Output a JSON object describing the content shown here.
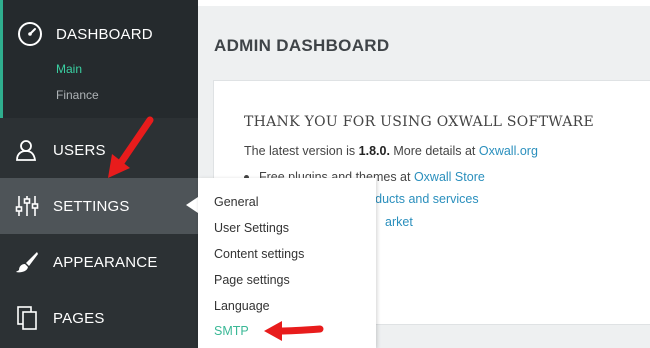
{
  "sidebar": {
    "dashboard": {
      "label": "DASHBOARD",
      "icon": "dashboard-gauge-icon"
    },
    "submenu": [
      {
        "label": "Main",
        "active": true
      },
      {
        "label": "Finance",
        "active": false
      }
    ],
    "users": {
      "label": "USERS",
      "icon": "user-icon"
    },
    "settings": {
      "label": "SETTINGS",
      "icon": "sliders-icon"
    },
    "appearance": {
      "label": "APPEARANCE",
      "icon": "paintbrush-icon"
    },
    "pages": {
      "label": "PAGES",
      "icon": "pages-icon"
    }
  },
  "flyout": {
    "items": [
      {
        "label": "General"
      },
      {
        "label": "User Settings"
      },
      {
        "label": "Content settings"
      },
      {
        "label": "Page settings"
      },
      {
        "label": "Language"
      },
      {
        "label": "SMTP"
      }
    ]
  },
  "main": {
    "title": "ADMIN DASHBOARD",
    "panel": {
      "heading": "THANK YOU FOR USING OXWALL SOFTWARE",
      "version_prefix": "The latest version is ",
      "version": "1.8.0.",
      "version_suffix": " More details at ",
      "version_link": "Oxwall.org",
      "bullet1_prefix": "Free plugins and themes at ",
      "bullet1_link": "Oxwall Store",
      "bullet2_text": "roducts and services",
      "bullet3_text": "arket"
    }
  },
  "colors": {
    "sidebar_bg": "#2c3134",
    "active_nav_bg": "#4e5458",
    "accent_green": "#3ad0a2",
    "link_blue": "#2a8fbd",
    "arrow_red": "#e81c1c"
  }
}
